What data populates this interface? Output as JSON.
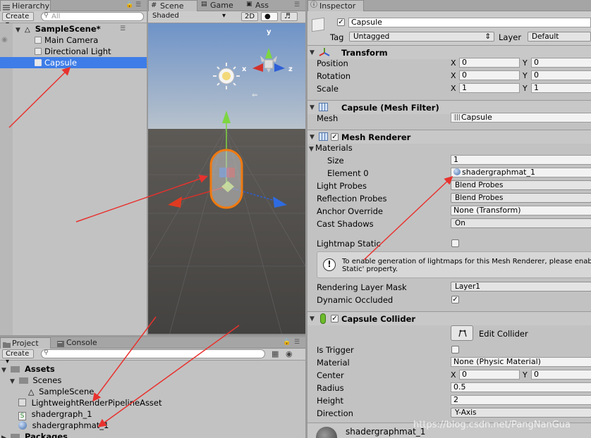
{
  "hierarchy": {
    "tab": "Hierarchy",
    "create": "Create",
    "search_placeholder": "All",
    "scene": "SampleScene*",
    "items": [
      "Main Camera",
      "Directional Light",
      "Capsule"
    ]
  },
  "scene_view": {
    "tabs": [
      "Scene",
      "Game",
      "Ass"
    ],
    "shading": "Shaded",
    "mode_2d": "2D",
    "gizmo_axes": {
      "y": "y",
      "x": "x",
      "z": "z"
    }
  },
  "project": {
    "tabs": [
      "Project",
      "Console"
    ],
    "create": "Create",
    "tree": [
      {
        "label": "Assets",
        "level": 0
      },
      {
        "label": "Scenes",
        "level": 1
      },
      {
        "label": "SampleScene",
        "level": 2
      },
      {
        "label": "LightweightRenderPipelineAsset",
        "level": 1
      },
      {
        "label": "shadergraph_1",
        "level": 1
      },
      {
        "label": "shadergraphmat_1",
        "level": 1
      },
      {
        "label": "Packages",
        "level": 0
      }
    ]
  },
  "inspector": {
    "tab": "Inspector",
    "object_name": "Capsule",
    "tag_label": "Tag",
    "tag_value": "Untagged",
    "layer_label": "Layer",
    "layer_value": "Default",
    "transform": {
      "title": "Transform",
      "position": {
        "label": "Position",
        "x": "0",
        "y": "0"
      },
      "rotation": {
        "label": "Rotation",
        "x": "0",
        "y": "0"
      },
      "scale": {
        "label": "Scale",
        "x": "1",
        "y": "1"
      }
    },
    "mesh_filter": {
      "title": "Capsule (Mesh Filter)",
      "mesh_label": "Mesh",
      "mesh_value": "Capsule"
    },
    "mesh_renderer": {
      "title": "Mesh Renderer",
      "materials_label": "Materials",
      "size_label": "Size",
      "size_value": "1",
      "element0_label": "Element 0",
      "element0_value": "shadergraphmat_1",
      "light_probes_label": "Light Probes",
      "light_probes_value": "Blend Probes",
      "reflection_probes_label": "Reflection Probes",
      "reflection_probes_value": "Blend Probes",
      "anchor_override_label": "Anchor Override",
      "anchor_override_value": "None (Transform)",
      "cast_shadows_label": "Cast Shadows",
      "cast_shadows_value": "On",
      "lightmap_static_label": "Lightmap Static",
      "info_line1": "To enable generation of lightmaps for this Mesh Renderer, please enab",
      "info_line2": "Static' property.",
      "rendering_layer_label": "Rendering Layer Mask",
      "rendering_layer_value": "Layer1",
      "dynamic_occluded_label": "Dynamic Occluded"
    },
    "capsule_collider": {
      "title": "Capsule Collider",
      "edit_collider": "Edit Collider",
      "is_trigger_label": "Is Trigger",
      "material_label": "Material",
      "material_value": "None (Physic Material)",
      "center_label": "Center",
      "center_x": "0",
      "center_y": "0",
      "radius_label": "Radius",
      "radius_value": "0.5",
      "height_label": "Height",
      "height_value": "2",
      "direction_label": "Direction",
      "direction_value": "Y-Axis"
    },
    "material_preview_name": "shadergraphmat_1"
  },
  "watermark": "https://blog.csdn.net/PangNanGua",
  "colors": {
    "selection": "#3e7de7",
    "annotation_arrow": "#e8322e"
  }
}
